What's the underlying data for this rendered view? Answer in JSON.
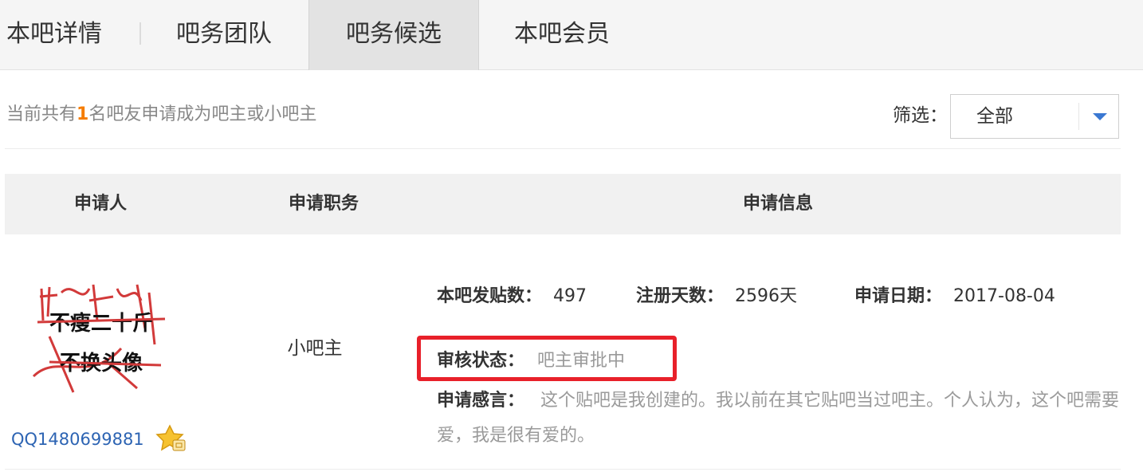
{
  "tabs": [
    {
      "label": "本吧详情"
    },
    {
      "label": "吧务团队"
    },
    {
      "label": "吧务候选"
    },
    {
      "label": "本吧会员"
    }
  ],
  "active_tab": "吧务候选",
  "summary": {
    "prefix": "当前共有",
    "count": "1",
    "suffix": "名吧友申请成为吧主或小吧主"
  },
  "filter": {
    "label": "筛选：",
    "selected": "全部"
  },
  "table": {
    "headers": [
      "申请人",
      "申请职务",
      "申请信息"
    ]
  },
  "applicant": {
    "avatar_text": [
      "不瘦二十斤",
      "不换头像"
    ],
    "username": "QQ1480699881",
    "role": "小吧主",
    "posts_label": "本吧发贴数：",
    "posts_value": "497",
    "days_label": "注册天数：",
    "days_value": "2596天",
    "date_label": "申请日期：",
    "date_value": "2017-08-04",
    "status_label": "审核状态：",
    "status_value": "吧主审批中",
    "statement_label": "申请感言：",
    "statement_value": "这个贴吧是我创建的。我以前在其它贴吧当过吧主。个人认为，这个吧需要爱，我是很有爱的。"
  },
  "colors": {
    "accent": "#f57c00",
    "link": "#2d64b3",
    "highlight": "#e8202a",
    "arrow": "#3a78d2"
  },
  "icons": {
    "badge": "star-badge-icon",
    "dropdown": "caret-down-icon"
  }
}
